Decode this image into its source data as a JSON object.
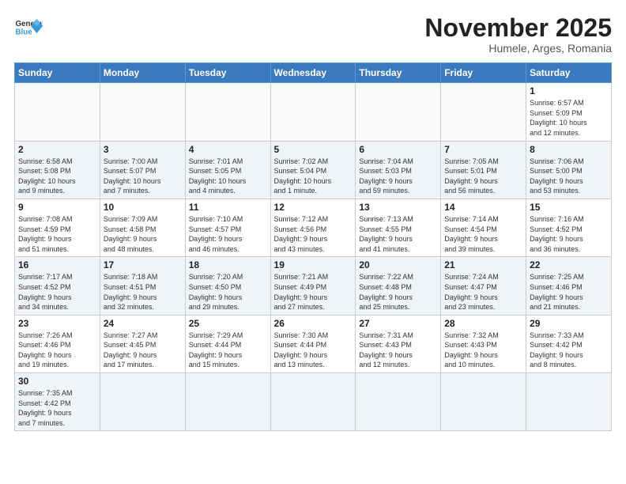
{
  "header": {
    "logo_general": "General",
    "logo_blue": "Blue",
    "month": "November 2025",
    "location": "Humele, Arges, Romania"
  },
  "weekdays": [
    "Sunday",
    "Monday",
    "Tuesday",
    "Wednesday",
    "Thursday",
    "Friday",
    "Saturday"
  ],
  "rows": [
    [
      {
        "num": "",
        "info": ""
      },
      {
        "num": "",
        "info": ""
      },
      {
        "num": "",
        "info": ""
      },
      {
        "num": "",
        "info": ""
      },
      {
        "num": "",
        "info": ""
      },
      {
        "num": "",
        "info": ""
      },
      {
        "num": "1",
        "info": "Sunrise: 6:57 AM\nSunset: 5:09 PM\nDaylight: 10 hours\nand 12 minutes."
      }
    ],
    [
      {
        "num": "2",
        "info": "Sunrise: 6:58 AM\nSunset: 5:08 PM\nDaylight: 10 hours\nand 9 minutes."
      },
      {
        "num": "3",
        "info": "Sunrise: 7:00 AM\nSunset: 5:07 PM\nDaylight: 10 hours\nand 7 minutes."
      },
      {
        "num": "4",
        "info": "Sunrise: 7:01 AM\nSunset: 5:05 PM\nDaylight: 10 hours\nand 4 minutes."
      },
      {
        "num": "5",
        "info": "Sunrise: 7:02 AM\nSunset: 5:04 PM\nDaylight: 10 hours\nand 1 minute."
      },
      {
        "num": "6",
        "info": "Sunrise: 7:04 AM\nSunset: 5:03 PM\nDaylight: 9 hours\nand 59 minutes."
      },
      {
        "num": "7",
        "info": "Sunrise: 7:05 AM\nSunset: 5:01 PM\nDaylight: 9 hours\nand 56 minutes."
      },
      {
        "num": "8",
        "info": "Sunrise: 7:06 AM\nSunset: 5:00 PM\nDaylight: 9 hours\nand 53 minutes."
      }
    ],
    [
      {
        "num": "9",
        "info": "Sunrise: 7:08 AM\nSunset: 4:59 PM\nDaylight: 9 hours\nand 51 minutes."
      },
      {
        "num": "10",
        "info": "Sunrise: 7:09 AM\nSunset: 4:58 PM\nDaylight: 9 hours\nand 48 minutes."
      },
      {
        "num": "11",
        "info": "Sunrise: 7:10 AM\nSunset: 4:57 PM\nDaylight: 9 hours\nand 46 minutes."
      },
      {
        "num": "12",
        "info": "Sunrise: 7:12 AM\nSunset: 4:56 PM\nDaylight: 9 hours\nand 43 minutes."
      },
      {
        "num": "13",
        "info": "Sunrise: 7:13 AM\nSunset: 4:55 PM\nDaylight: 9 hours\nand 41 minutes."
      },
      {
        "num": "14",
        "info": "Sunrise: 7:14 AM\nSunset: 4:54 PM\nDaylight: 9 hours\nand 39 minutes."
      },
      {
        "num": "15",
        "info": "Sunrise: 7:16 AM\nSunset: 4:52 PM\nDaylight: 9 hours\nand 36 minutes."
      }
    ],
    [
      {
        "num": "16",
        "info": "Sunrise: 7:17 AM\nSunset: 4:52 PM\nDaylight: 9 hours\nand 34 minutes."
      },
      {
        "num": "17",
        "info": "Sunrise: 7:18 AM\nSunset: 4:51 PM\nDaylight: 9 hours\nand 32 minutes."
      },
      {
        "num": "18",
        "info": "Sunrise: 7:20 AM\nSunset: 4:50 PM\nDaylight: 9 hours\nand 29 minutes."
      },
      {
        "num": "19",
        "info": "Sunrise: 7:21 AM\nSunset: 4:49 PM\nDaylight: 9 hours\nand 27 minutes."
      },
      {
        "num": "20",
        "info": "Sunrise: 7:22 AM\nSunset: 4:48 PM\nDaylight: 9 hours\nand 25 minutes."
      },
      {
        "num": "21",
        "info": "Sunrise: 7:24 AM\nSunset: 4:47 PM\nDaylight: 9 hours\nand 23 minutes."
      },
      {
        "num": "22",
        "info": "Sunrise: 7:25 AM\nSunset: 4:46 PM\nDaylight: 9 hours\nand 21 minutes."
      }
    ],
    [
      {
        "num": "23",
        "info": "Sunrise: 7:26 AM\nSunset: 4:46 PM\nDaylight: 9 hours\nand 19 minutes."
      },
      {
        "num": "24",
        "info": "Sunrise: 7:27 AM\nSunset: 4:45 PM\nDaylight: 9 hours\nand 17 minutes."
      },
      {
        "num": "25",
        "info": "Sunrise: 7:29 AM\nSunset: 4:44 PM\nDaylight: 9 hours\nand 15 minutes."
      },
      {
        "num": "26",
        "info": "Sunrise: 7:30 AM\nSunset: 4:44 PM\nDaylight: 9 hours\nand 13 minutes."
      },
      {
        "num": "27",
        "info": "Sunrise: 7:31 AM\nSunset: 4:43 PM\nDaylight: 9 hours\nand 12 minutes."
      },
      {
        "num": "28",
        "info": "Sunrise: 7:32 AM\nSunset: 4:43 PM\nDaylight: 9 hours\nand 10 minutes."
      },
      {
        "num": "29",
        "info": "Sunrise: 7:33 AM\nSunset: 4:42 PM\nDaylight: 9 hours\nand 8 minutes."
      }
    ],
    [
      {
        "num": "30",
        "info": "Sunrise: 7:35 AM\nSunset: 4:42 PM\nDaylight: 9 hours\nand 7 minutes."
      },
      {
        "num": "",
        "info": ""
      },
      {
        "num": "",
        "info": ""
      },
      {
        "num": "",
        "info": ""
      },
      {
        "num": "",
        "info": ""
      },
      {
        "num": "",
        "info": ""
      },
      {
        "num": "",
        "info": ""
      }
    ]
  ]
}
